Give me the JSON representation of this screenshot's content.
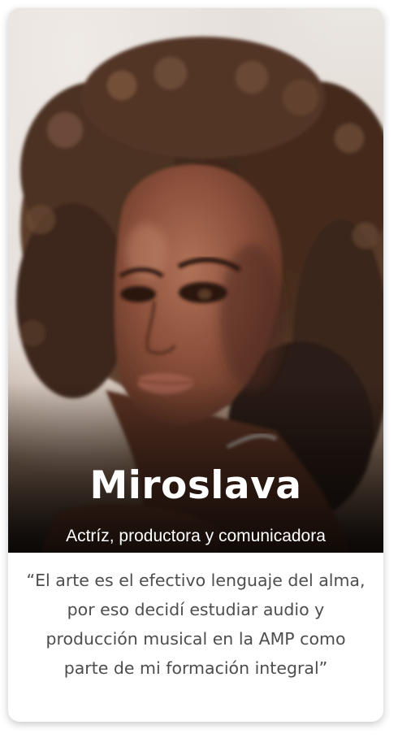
{
  "profile": {
    "name": "Miroslava",
    "role": "Actríz, productora y comunicadora",
    "quote": "“El arte es el efectivo lenguaje del alma, por eso decidí estudiar audio y producción musical en la AMP como parte de mi formación integral”"
  },
  "colors": {
    "card_background": "#ffffff",
    "name_text": "#ffffff",
    "quote_text": "#4d4d4d"
  }
}
